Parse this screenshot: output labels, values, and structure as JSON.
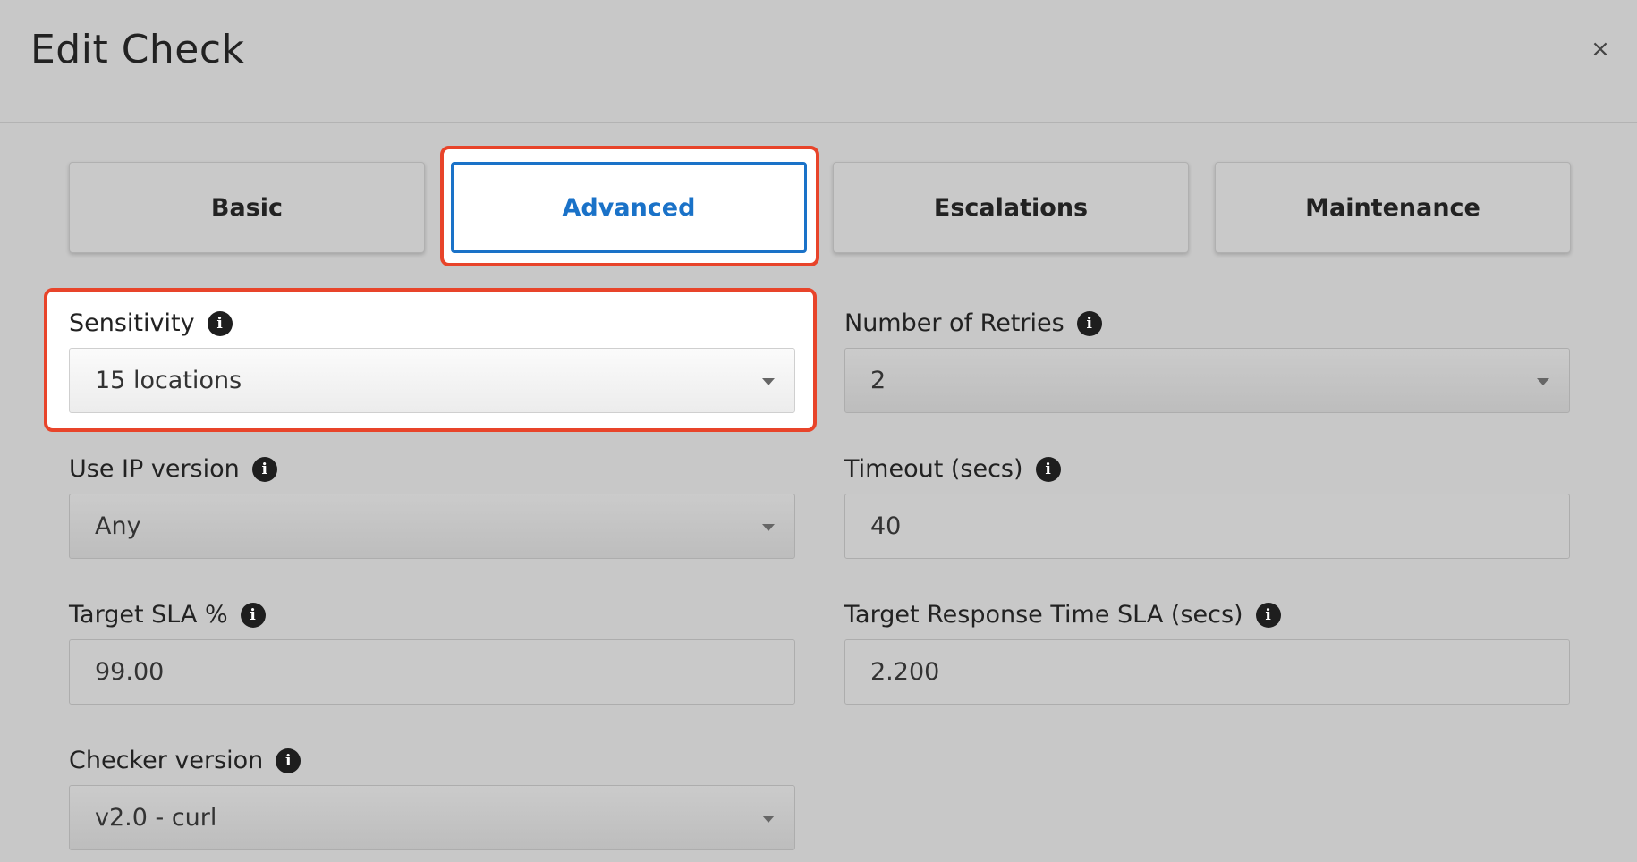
{
  "dialog": {
    "title": "Edit Check",
    "close_label": "×"
  },
  "tabs": [
    {
      "label": "Basic"
    },
    {
      "label": "Advanced"
    },
    {
      "label": "Escalations"
    },
    {
      "label": "Maintenance"
    }
  ],
  "fields": {
    "sensitivity": {
      "label": "Sensitivity",
      "value": "15 locations"
    },
    "retries": {
      "label": "Number of Retries",
      "value": "2"
    },
    "ip_version": {
      "label": "Use IP version",
      "value": "Any"
    },
    "timeout": {
      "label": "Timeout (secs)",
      "value": "40"
    },
    "target_sla": {
      "label": "Target SLA %",
      "value": "99.00"
    },
    "response_sla": {
      "label": "Target Response Time SLA (secs)",
      "value": "2.200"
    },
    "checker_version": {
      "label": "Checker version",
      "value": "v2.0 - curl"
    }
  },
  "colors": {
    "accent": "#1a72c8",
    "highlight": "#e8442a",
    "background": "#c8c8c8"
  },
  "icons": {
    "info": "info-icon",
    "caret": "chevron-down-icon",
    "close": "close-icon"
  }
}
